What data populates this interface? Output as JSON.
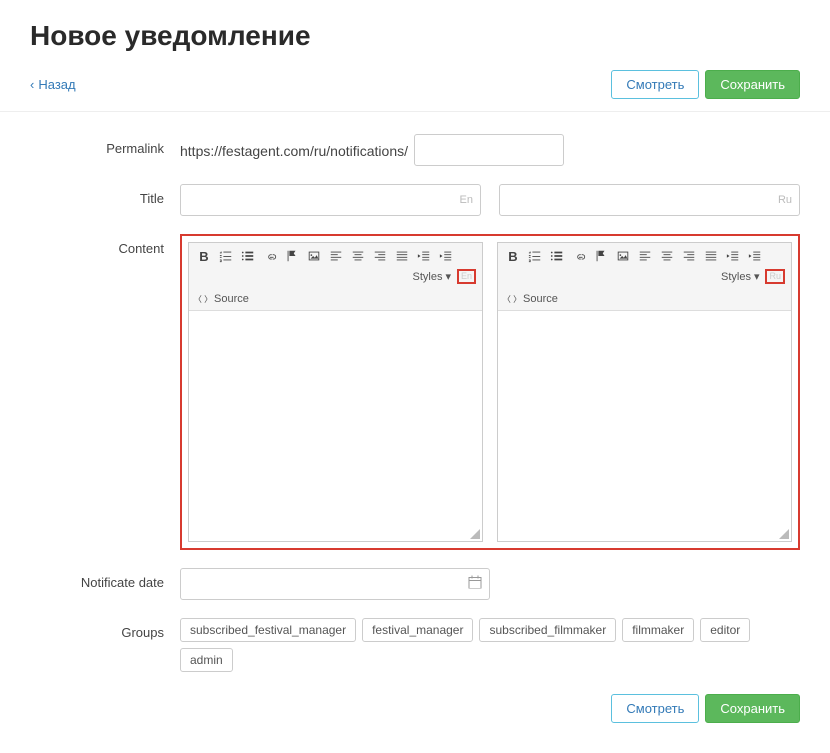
{
  "page_title": "Новое уведомление",
  "back_label": "Назад",
  "buttons": {
    "view": "Смотреть",
    "save": "Сохранить"
  },
  "form": {
    "permalink_label": "Permalink",
    "permalink_prefix": "https://festagent.com/ru/notifications/",
    "permalink_value": "",
    "title_label": "Title",
    "title_en_value": "",
    "title_ru_value": "",
    "lang_en": "En",
    "lang_ru": "Ru",
    "content_label": "Content",
    "notificate_date_label": "Notificate date",
    "notificate_date_value": "",
    "groups_label": "Groups"
  },
  "editor": {
    "styles_label": "Styles",
    "source_label": "Source"
  },
  "groups": [
    "subscribed_festival_manager",
    "festival_manager",
    "subscribed_filmmaker",
    "filmmaker",
    "editor",
    "admin"
  ]
}
